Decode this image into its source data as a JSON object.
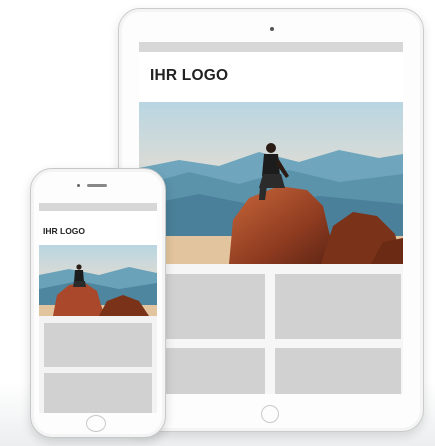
{
  "tablet": {
    "logo_text": "IHR LOGO",
    "tiles": 4
  },
  "phone": {
    "logo_text": "IHR LOGO",
    "tiles": 2
  },
  "colors": {
    "tile": "#d1d1d1",
    "topbar": "#d7d7d7",
    "device_border": "#c9cbcd"
  },
  "icons": [
    "camera-icon",
    "speaker-icon",
    "home-button-icon",
    "mountain-photo"
  ]
}
